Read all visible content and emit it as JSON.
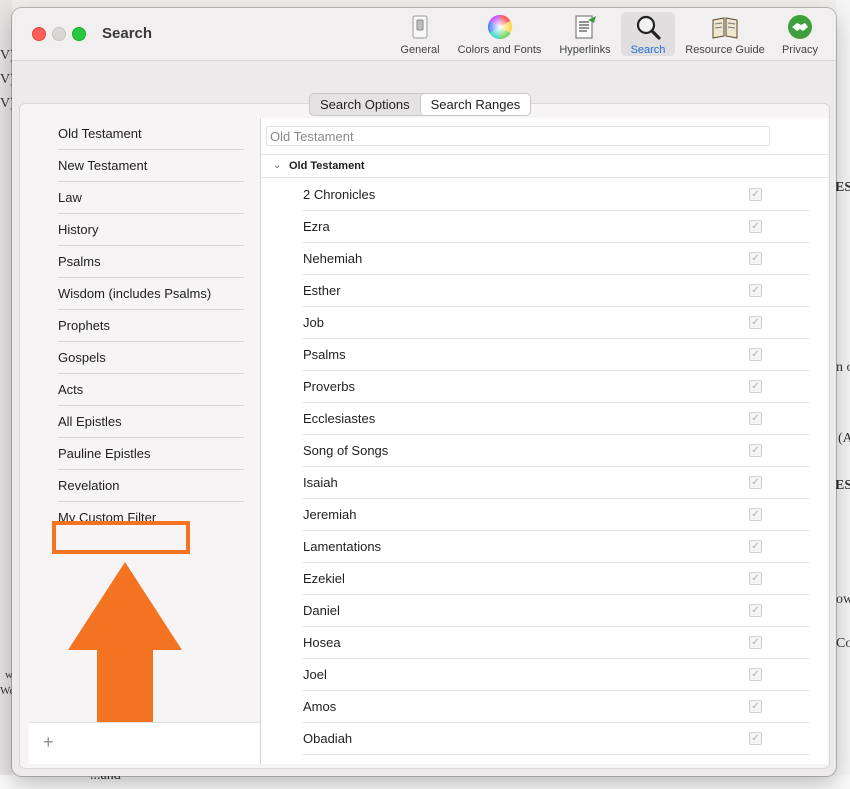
{
  "window": {
    "title": "Search"
  },
  "toolbar": {
    "items": [
      {
        "label": "General",
        "icon": "switch-icon",
        "selected": false
      },
      {
        "label": "Colors and Fonts",
        "icon": "color-wheel-icon",
        "selected": false
      },
      {
        "label": "Hyperlinks",
        "icon": "document-link-icon",
        "selected": false
      },
      {
        "label": "Search",
        "icon": "magnifier-icon",
        "selected": true
      },
      {
        "label": "Resource Guide",
        "icon": "open-book-icon",
        "selected": false
      },
      {
        "label": "Privacy",
        "icon": "handshake-icon",
        "selected": false
      }
    ]
  },
  "tabs": {
    "search_options": "Search Options",
    "search_ranges": "Search Ranges",
    "active": "Search Ranges"
  },
  "ranges": [
    "Old Testament",
    "New Testament",
    "Law",
    "History",
    "Psalms",
    "Wisdom (includes Psalms)",
    "Prophets",
    "Gospels",
    "Acts",
    "All Epistles",
    "Pauline Epistles",
    "Revelation",
    "My Custom Filter"
  ],
  "highlighted_range": "My Custom Filter",
  "add_button": "+",
  "range_name_field": {
    "value": "Old Testament"
  },
  "book_group": {
    "label": "Old Testament",
    "expanded": true
  },
  "books": [
    "2 Chronicles",
    "Ezra",
    "Nehemiah",
    "Esther",
    "Job",
    "Psalms",
    "Proverbs",
    "Ecclesiastes",
    "Song of Songs",
    "Isaiah",
    "Jeremiah",
    "Lamentations",
    "Ezekiel",
    "Daniel",
    "Hosea",
    "Joel",
    "Amos",
    "Obadiah"
  ],
  "book_checked": true,
  "check_glyph": "✓",
  "chevron_glyph": "⌄",
  "background_fragments": [
    "V)",
    "V)",
    "V)",
    "EST",
    "n or",
    "(A",
    "EST",
    "ow",
    "Co",
    "w",
    "Wo",
    "...and"
  ],
  "colors": {
    "highlight": "#f47321",
    "accent": "#1e6fd9"
  }
}
